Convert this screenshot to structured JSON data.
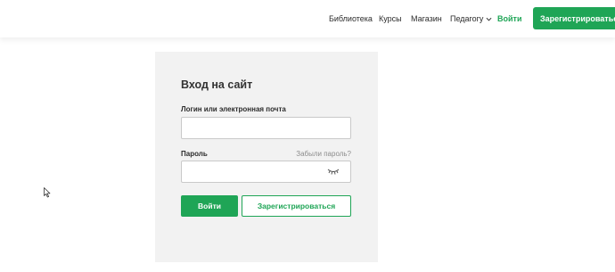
{
  "header": {
    "nav": {
      "library": "Библиотека",
      "courses": "Курсы",
      "shop": "Магазин",
      "teacher": "Педагогу",
      "login": "Войти"
    },
    "register_button": "Зарегистрироваться",
    "accent_color": "#1fa556"
  },
  "login_form": {
    "title": "Вход на сайт",
    "login_label": "Логин или электронная почта",
    "login_value": "",
    "password_label": "Пароль",
    "forgot_link": "Забыли пароль?",
    "password_value": "",
    "password_toggle_icon": "eye-closed-icon",
    "submit_button": "Войти",
    "register_button": "Зарегистрироваться"
  }
}
